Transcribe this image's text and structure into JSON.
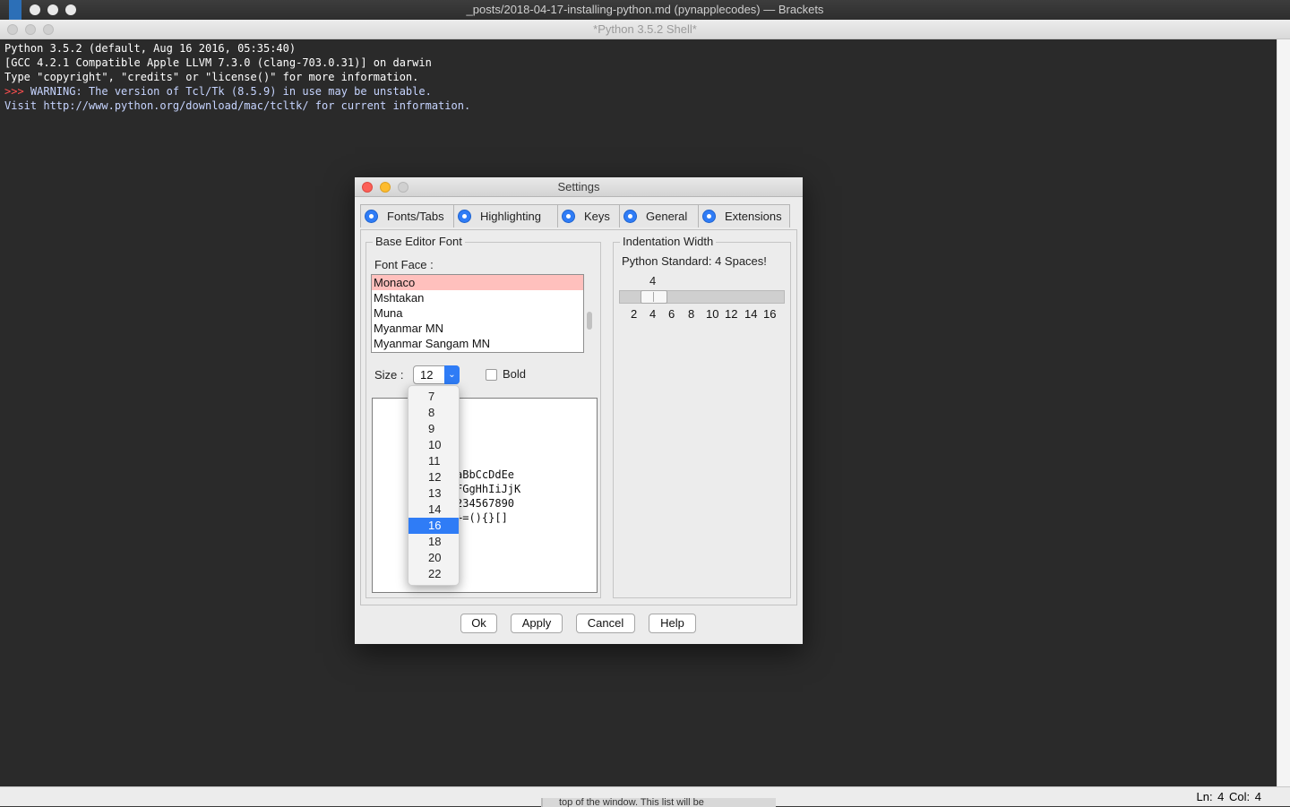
{
  "brackets": {
    "title": "_posts/2018-04-17-installing-python.md (pynapplecodes) — Brackets"
  },
  "shell": {
    "title": "*Python 3.5.2 Shell*",
    "lines": [
      "Python 3.5.2 (default, Aug 16 2016, 05:35:40)",
      "[GCC 4.2.1 Compatible Apple LLVM 7.3.0 (clang-703.0.31)] on darwin",
      "Type \"copyright\", \"credits\" or \"license()\" for more information."
    ],
    "warning_prompt": ">>> ",
    "warning_text": "WARNING: The version of Tcl/Tk (8.5.9) in use may be unstable.",
    "visit_line": "Visit http://www.python.org/download/mac/tcltk/ for current information."
  },
  "statusbar": {
    "position": "Ln: 4   Col: 4",
    "background_fragment": "top of the window. This list will be"
  },
  "settings": {
    "title": "Settings",
    "tabs": [
      "Fonts/Tabs",
      "Highlighting",
      "Keys",
      "General",
      "Extensions"
    ],
    "selected_tab": "Fonts/Tabs",
    "base_font_group": "Base Editor Font",
    "font_face_label": "Font Face :",
    "fonts": [
      "Monaco",
      "Mshtakan",
      "Muna",
      "Myanmar MN",
      "Myanmar Sangam MN"
    ],
    "selected_font": "Monaco",
    "size_label": "Size :",
    "size_value": "12",
    "bold_label": "Bold",
    "bold_checked": false,
    "sample_lines": [
      "aBbCcDdEe",
      "FGgHhIiJjK",
      "234567890",
      "+=(){}[]"
    ],
    "indent_group": "Indentation Width",
    "indent_text": "Python Standard: 4 Spaces!",
    "indent_value": "4",
    "indent_ticks": [
      "2",
      "4",
      "6",
      "8",
      "10",
      "12",
      "14",
      "16"
    ],
    "buttons": {
      "ok": "Ok",
      "apply": "Apply",
      "cancel": "Cancel",
      "help": "Help"
    }
  },
  "size_popup": {
    "options": [
      "7",
      "8",
      "9",
      "10",
      "11",
      "12",
      "13",
      "14",
      "16",
      "18",
      "20",
      "22"
    ],
    "highlighted": "16"
  },
  "colors": {
    "accent": "#2f7cf6",
    "selection": "#ffc0bd",
    "shell_bg": "#2a2a2a",
    "warning": "#ff4f4f"
  }
}
